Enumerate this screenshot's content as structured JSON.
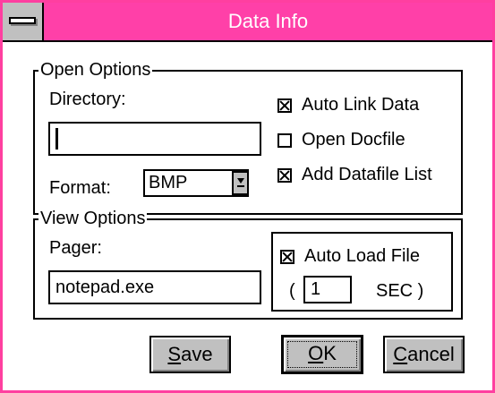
{
  "window": {
    "title": "Data Info"
  },
  "open_options": {
    "legend": "Open Options",
    "directory_label": "Directory:",
    "directory_value": "",
    "format_label": "Format:",
    "format_value": "BMP",
    "auto_link_data": {
      "label": "Auto Link Data",
      "checked": true
    },
    "open_docfile": {
      "label": "Open Docfile",
      "checked": false
    },
    "add_datafile_list": {
      "label": "Add Datafile List",
      "checked": true
    }
  },
  "view_options": {
    "legend": "View Options",
    "pager_label": "Pager:",
    "pager_value": "notepad.exe",
    "auto_load_file": {
      "label": "Auto Load File",
      "checked": true
    },
    "paren_open": "(",
    "interval_value": "1",
    "interval_unit": "SEC )"
  },
  "buttons": {
    "save": {
      "mnemonic": "S",
      "rest": "ave"
    },
    "ok": {
      "mnemonic": "O",
      "rest": "K"
    },
    "cancel": {
      "mnemonic": "C",
      "rest": "ancel"
    }
  },
  "colors": {
    "title_bar": "#ff40a8",
    "button_face": "#c0c0c0",
    "background": "#ffffff"
  },
  "icons": {
    "system_menu": "minus-bar-icon",
    "dropdown": "arrow-down-icon"
  }
}
